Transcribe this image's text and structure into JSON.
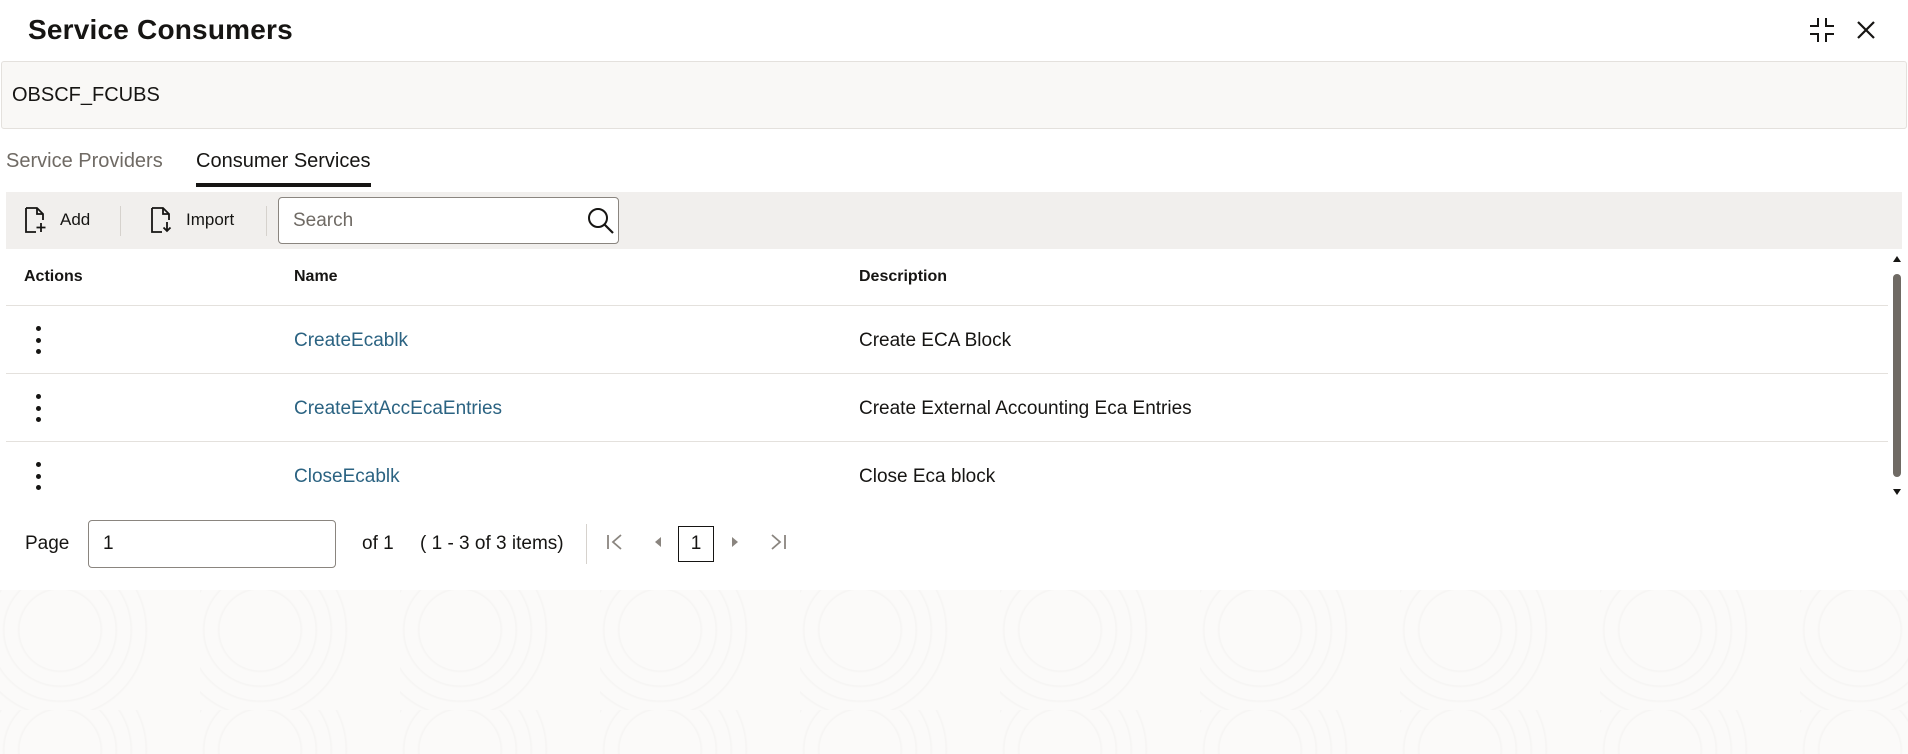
{
  "dialog": {
    "title": "Service Consumers",
    "compress_icon": "compress-icon",
    "close_icon": "close-icon"
  },
  "context": {
    "value": "OBSCF_FCUBS"
  },
  "tabs": [
    {
      "label": "Service Providers",
      "active": false
    },
    {
      "label": "Consumer Services",
      "active": true
    }
  ],
  "toolbar": {
    "add_label": "Add",
    "import_label": "Import",
    "search_placeholder": "Search"
  },
  "table": {
    "headers": {
      "actions": "Actions",
      "name": "Name",
      "description": "Description"
    },
    "rows": [
      {
        "name": "CreateEcablk",
        "description": "Create ECA Block"
      },
      {
        "name": "CreateExtAccEcaEntries",
        "description": "Create External Accounting Eca Entries"
      },
      {
        "name": "CloseEcablk",
        "description": "Close Eca block"
      }
    ]
  },
  "pagination": {
    "page_label": "Page",
    "page_value": "1",
    "of_text": "of 1",
    "items_text": "( 1 - 3 of 3 items)",
    "current_page": "1"
  },
  "colors": {
    "link": "#2b6382",
    "toolbar_bg": "#f1efed",
    "context_bg": "#f9f8f6"
  }
}
